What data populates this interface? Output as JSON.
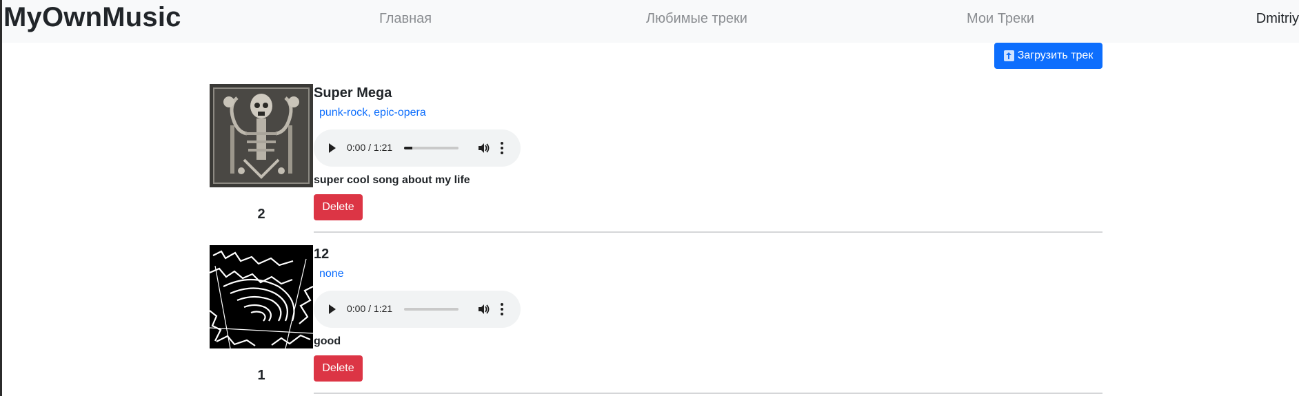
{
  "nav": {
    "brand": "MyOwnMusic",
    "home": "Главная",
    "favorites": "Любимые треки",
    "my_tracks": "Мои Треки",
    "user": "Dmitriy"
  },
  "upload_button": {
    "label": "Загрузить трек",
    "icon": "upload-arrow-icon"
  },
  "tracks": [
    {
      "title": "Super Mega",
      "tags": "punk-rock, epic-opera",
      "time": "0:00 / 1:21",
      "progress": 0.15,
      "description": "super cool song about my life",
      "delete_label": "Delete",
      "number": "2",
      "cover": "skull-art-cover"
    },
    {
      "title": "12",
      "tags": "none",
      "time": "0:00 / 1:21",
      "progress": 0,
      "description": "good",
      "delete_label": "Delete",
      "number": "1",
      "cover": "black-white-spiral-cover"
    }
  ],
  "colors": {
    "primary": "#0d6efd",
    "danger": "#dc3545",
    "navbar_bg": "#f8f9fa",
    "player_bg": "#f1f3f4"
  }
}
